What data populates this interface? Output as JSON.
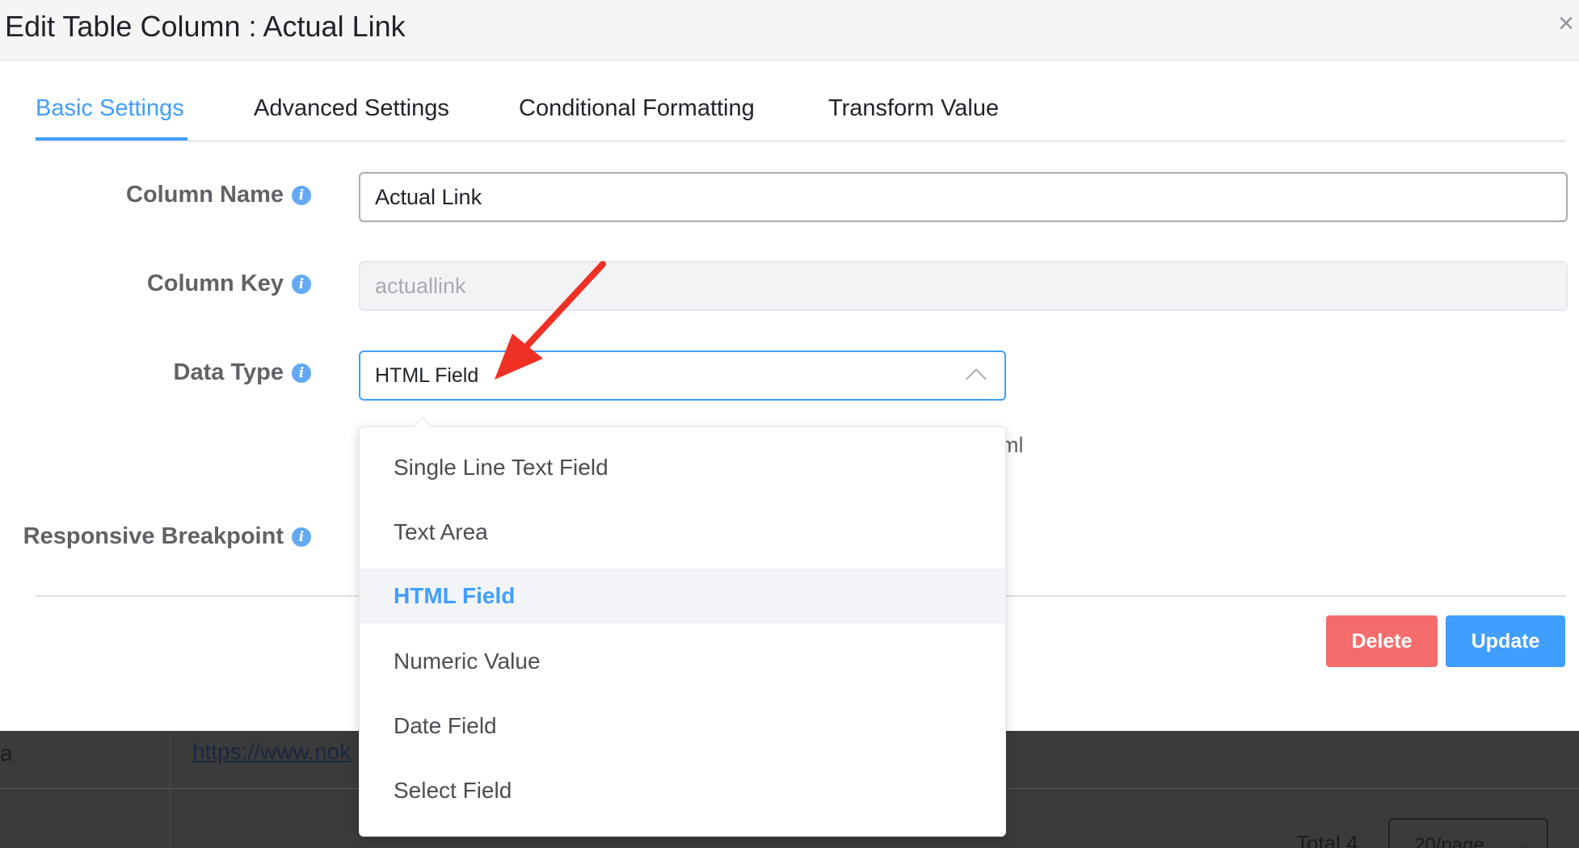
{
  "modal": {
    "title": "Edit Table Column : Actual Link",
    "close_label": "×",
    "tabs": [
      {
        "label": "Basic Settings",
        "active": true
      },
      {
        "label": "Advanced Settings",
        "active": false
      },
      {
        "label": "Conditional Formatting",
        "active": false
      },
      {
        "label": "Transform Value",
        "active": false
      }
    ],
    "fields": {
      "column_name": {
        "label": "Column Name",
        "value": "Actual Link"
      },
      "column_key": {
        "label": "Column Key",
        "placeholder": "actuallink"
      },
      "data_type": {
        "label": "Data Type",
        "value": "HTML Field"
      },
      "responsive_breakpoint": {
        "label": "Responsive Breakpoint"
      }
    },
    "hint_fragment": "ml",
    "buttons": {
      "delete": "Delete",
      "update": "Update"
    }
  },
  "dropdown": {
    "options": [
      {
        "label": "Single Line Text Field",
        "selected": false
      },
      {
        "label": "Text Area",
        "selected": false
      },
      {
        "label": "HTML Field",
        "selected": true
      },
      {
        "label": "Numeric Value",
        "selected": false
      },
      {
        "label": "Date Field",
        "selected": false
      },
      {
        "label": "Select Field",
        "selected": false
      }
    ]
  },
  "background": {
    "cell_fragment": "a",
    "link_text": "https://www.nok",
    "total_text": "Total 4",
    "page_size": "20/page"
  },
  "colors": {
    "accent": "#409eff",
    "danger": "#f56c6c",
    "annotation_arrow": "#ee3124"
  }
}
